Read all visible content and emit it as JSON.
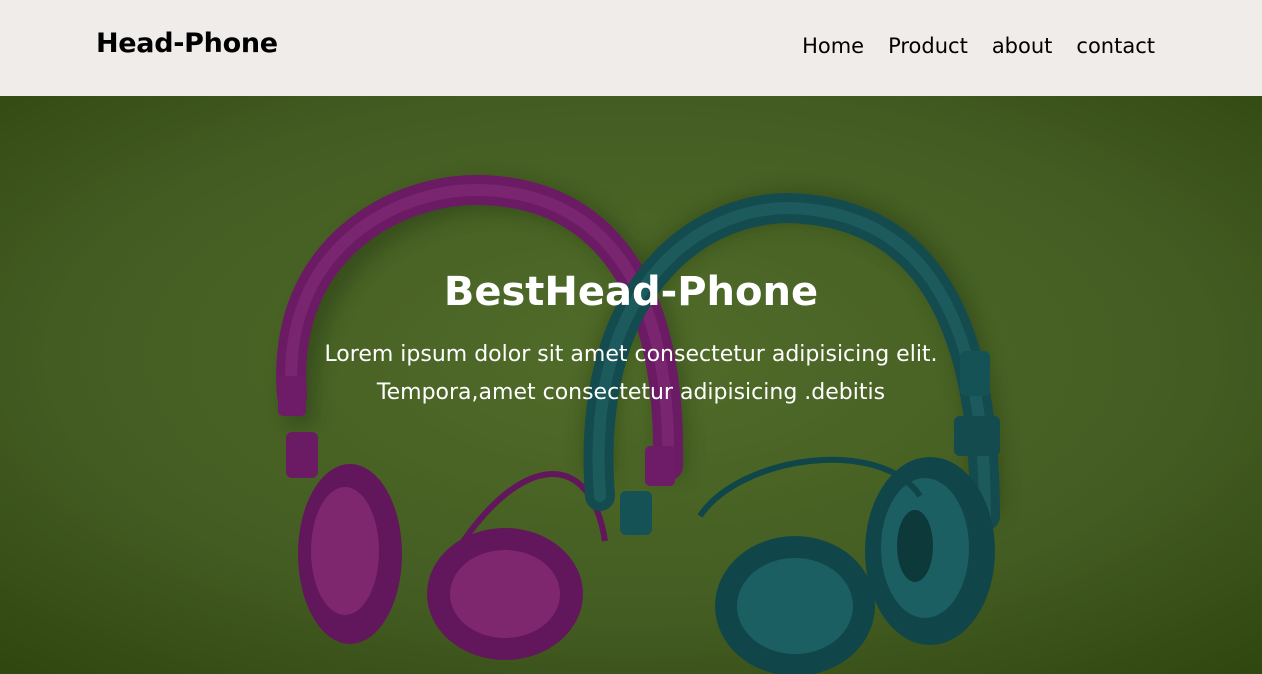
{
  "header": {
    "logo": "Head-Phone",
    "nav": [
      "Home",
      "Product",
      "about",
      "contact"
    ]
  },
  "hero": {
    "title": "BestHead-Phone",
    "line1": "Lorem ipsum dolor sit amet consectetur adipisicing elit.",
    "line2": "Tempora,amet consectetur adipisicing .debitis",
    "image": "headphones-photo"
  },
  "colors": {
    "navbar_bg": "#efecea",
    "hero_bg": "#4f6a2a",
    "magenta": "#9b2a8a",
    "teal": "#1e6f73",
    "text_light": "#ffffff"
  }
}
